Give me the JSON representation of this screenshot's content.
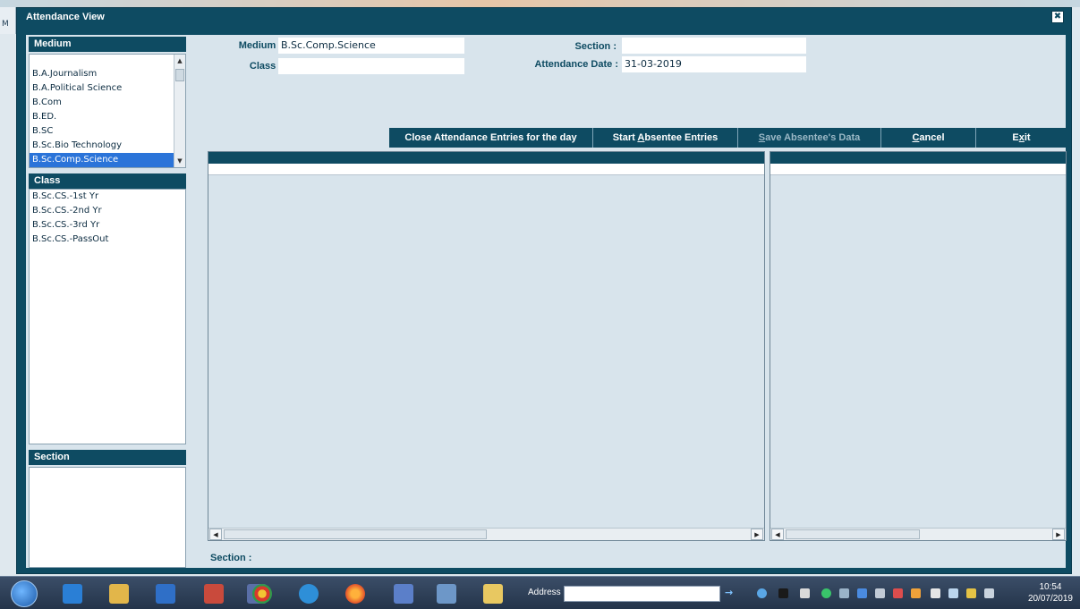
{
  "window": {
    "title": "Attendance View",
    "close_glyph": "✖"
  },
  "app_edge_label": "M",
  "medium_panel": {
    "header": "Medium",
    "items": [
      {
        "label": "B.A.Journalism",
        "selected": false
      },
      {
        "label": "B.A.Political Science",
        "selected": false
      },
      {
        "label": "B.Com",
        "selected": false
      },
      {
        "label": "B.ED.",
        "selected": false
      },
      {
        "label": "B.SC",
        "selected": false
      },
      {
        "label": "B.Sc.Bio Technology",
        "selected": false
      },
      {
        "label": "B.Sc.Comp.Science",
        "selected": true
      }
    ]
  },
  "class_panel": {
    "header": "Class",
    "items": [
      "B.Sc.CS.-1st Yr",
      "B.Sc.CS.-2nd Yr",
      "B.Sc.CS.-3rd Yr",
      "B.Sc.CS.-PassOut"
    ]
  },
  "section_panel": {
    "header": "Section"
  },
  "form": {
    "medium_label": "Medium :",
    "medium_value": "B.Sc.Comp.Science",
    "class_label": "Class :",
    "class_value": "",
    "section_label": "Section :",
    "section_value": "",
    "date_label": "Attendance Date :",
    "date_value": "31-03-2019"
  },
  "toolbar": {
    "close_entries": "Close Attendance Entries for the day",
    "start_absentee_pre": "Start ",
    "start_absentee_u": "A",
    "start_absentee_post": "bsentee Entries",
    "save_absentee_u": "S",
    "save_absentee_post": "ave Absentee's Data",
    "cancel_u": "C",
    "cancel_post": "ancel",
    "exit_pre": "E",
    "exit_u": "x",
    "exit_post": "it"
  },
  "status": {
    "section_label": "Section :"
  },
  "taskbar": {
    "address_label": "Address",
    "clock_time": "10:54",
    "clock_date": "20/07/2019"
  }
}
